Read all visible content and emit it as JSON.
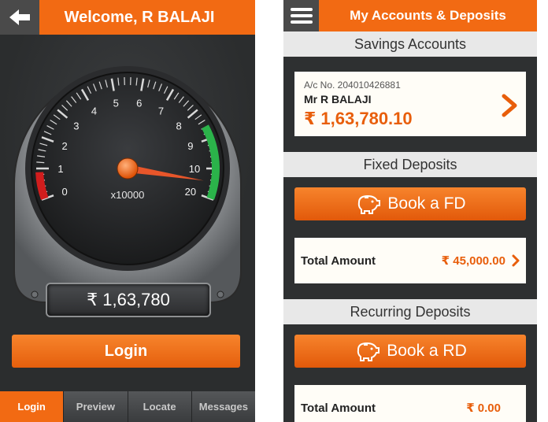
{
  "left": {
    "title": "Welcome, R BALAJI",
    "gauge": {
      "ticks": [
        "0",
        "1",
        "2",
        "3",
        "4",
        "5",
        "6",
        "7",
        "8",
        "9",
        "10",
        "20"
      ],
      "multiplier": "x10000",
      "needle_fraction": 0.95
    },
    "balance_display": "₹ 1,63,780",
    "login_label": "Login",
    "nav": [
      "Login",
      "Preview",
      "Locate",
      "Messages"
    ]
  },
  "right": {
    "title": "My Accounts & Deposits",
    "savings": {
      "section_title": "Savings Accounts",
      "account_no": "A/c No. 204010426881",
      "name": "Mr R BALAJI",
      "balance": "₹ 1,63,780.10"
    },
    "fixed": {
      "section_title": "Fixed Deposits",
      "button_label": "Book a FD",
      "total_label": "Total Amount",
      "total_value": "₹ 45,000.00"
    },
    "recurring": {
      "section_title": "Recurring Deposits",
      "button_label": "Book a RD",
      "total_label": "Total Amount",
      "total_value": "₹ 0.00"
    }
  },
  "colors": {
    "accent": "#f26a13",
    "dark": "#2b2d2e",
    "green": "#2bb34a",
    "red": "#d11d1d"
  }
}
